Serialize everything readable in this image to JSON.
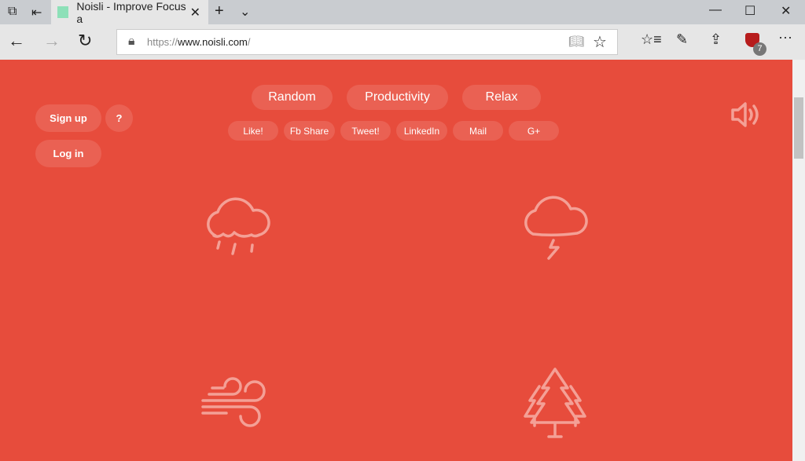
{
  "browser": {
    "tab_title": "Noisli - Improve Focus a",
    "url_prefix": "https://",
    "url_host": "www.noisli.com",
    "url_suffix": "/",
    "extension_badge": "7"
  },
  "nav": {
    "categories": [
      "Random",
      "Productivity",
      "Relax"
    ],
    "share": [
      "Like!",
      "Fb Share",
      "Tweet!",
      "LinkedIn",
      "Mail",
      "G+"
    ],
    "signup": "Sign up",
    "help": "?",
    "login": "Log in"
  },
  "sounds": [
    {
      "icon": "rain-icon"
    },
    {
      "icon": "thunderstorm-icon"
    },
    {
      "icon": "wind-icon"
    },
    {
      "icon": "forest-icon"
    }
  ],
  "colors": {
    "background": "#e74c3c",
    "button": "#ea6153",
    "icon": "#f4a096"
  }
}
